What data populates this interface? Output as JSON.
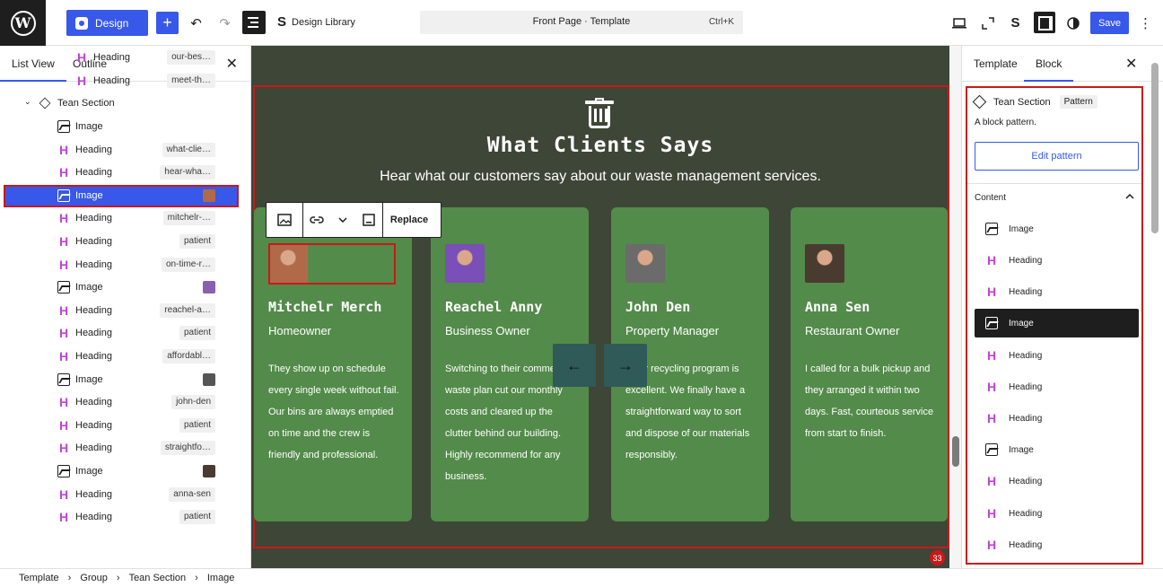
{
  "topbar": {
    "design_label": "Design",
    "plus": "+",
    "undo": "↶",
    "redo": "↷",
    "design_library_label": "Design Library",
    "command_title": "Front Page · Template",
    "command_shortcut": "Ctrl+K",
    "save_label": "Save",
    "more": "⋮"
  },
  "left_panel": {
    "tabs": [
      "List View",
      "Outline"
    ],
    "close": "✕",
    "rows": [
      {
        "type": "heading",
        "label": "Heading",
        "anchor": "our-bes…",
        "indent": 84
      },
      {
        "type": "heading",
        "label": "Heading",
        "anchor": "meet-th…",
        "indent": 84
      },
      {
        "type": "group",
        "label": "Tean Section",
        "anchor": "",
        "indent": 44
      },
      {
        "type": "image",
        "label": "Image",
        "anchor": "",
        "indent": 64
      },
      {
        "type": "heading",
        "label": "Heading",
        "anchor": "what-clie…",
        "indent": 64
      },
      {
        "type": "heading",
        "label": "Heading",
        "anchor": "hear-wha…",
        "indent": 64
      },
      {
        "type": "image",
        "label": "Image",
        "anchor": "",
        "indent": 64,
        "thumb": "#b06a4a",
        "selected": true
      },
      {
        "type": "heading",
        "label": "Heading",
        "anchor": "mitchelr-…",
        "indent": 64
      },
      {
        "type": "heading",
        "label": "Heading",
        "anchor": "patient",
        "indent": 64
      },
      {
        "type": "heading",
        "label": "Heading",
        "anchor": "on-time-r…",
        "indent": 64
      },
      {
        "type": "image",
        "label": "Image",
        "anchor": "",
        "indent": 64,
        "thumb": "#8a5fb0"
      },
      {
        "type": "heading",
        "label": "Heading",
        "anchor": "reachel-a…",
        "indent": 64
      },
      {
        "type": "heading",
        "label": "Heading",
        "anchor": "patient",
        "indent": 64
      },
      {
        "type": "heading",
        "label": "Heading",
        "anchor": "affordabl…",
        "indent": 64
      },
      {
        "type": "image",
        "label": "Image",
        "anchor": "",
        "indent": 64,
        "thumb": "#555555"
      },
      {
        "type": "heading",
        "label": "Heading",
        "anchor": "john-den",
        "indent": 64
      },
      {
        "type": "heading",
        "label": "Heading",
        "anchor": "patient",
        "indent": 64
      },
      {
        "type": "heading",
        "label": "Heading",
        "anchor": "straightfo…",
        "indent": 64
      },
      {
        "type": "image",
        "label": "Image",
        "anchor": "",
        "indent": 64,
        "thumb": "#4a3b30"
      },
      {
        "type": "heading",
        "label": "Heading",
        "anchor": "anna-sen",
        "indent": 64
      },
      {
        "type": "heading",
        "label": "Heading",
        "anchor": "patient",
        "indent": 64
      }
    ]
  },
  "canvas": {
    "title": "What Clients Says",
    "subtitle": "Hear what our customers say about our waste management services.",
    "toolbar_replace": "Replace",
    "prev_arrow": "←",
    "next_arrow": "→",
    "notice_count": "33",
    "cards": [
      {
        "name": "Mitchelr Merch",
        "role": "Homeowner",
        "quote": "They show up on schedule every single week without fail. Our bins are always emptied on time and the crew is friendly and professional.",
        "avatar": "#b06a4a"
      },
      {
        "name": "Reachel Anny",
        "role": "Business Owner",
        "quote": "Switching to their commercial waste plan cut our monthly costs and cleared up the clutter behind our building. Highly recommend for any business.",
        "avatar": "#7a4fb8"
      },
      {
        "name": "John Den",
        "role": "Property Manager",
        "quote": "Their recycling program is excellent. We finally have a straightforward way to sort and dispose of our materials responsibly.",
        "avatar": "#6b6b6b"
      },
      {
        "name": "Anna Sen",
        "role": "Restaurant Owner",
        "quote": "I called for a bulk pickup and they arranged it within two days. Fast, courteous service from start to finish.",
        "avatar": "#4a3b30"
      }
    ]
  },
  "right_panel": {
    "tabs": [
      "Template",
      "Block"
    ],
    "close": "✕",
    "block_name": "Tean Section",
    "block_badge": "Pattern",
    "block_desc": "A block pattern.",
    "edit_pattern": "Edit pattern",
    "content_label": "Content",
    "content_items": [
      {
        "type": "image",
        "label": "Image"
      },
      {
        "type": "heading",
        "label": "Heading"
      },
      {
        "type": "heading",
        "label": "Heading"
      },
      {
        "type": "image",
        "label": "Image",
        "active": true
      },
      {
        "type": "heading",
        "label": "Heading"
      },
      {
        "type": "heading",
        "label": "Heading"
      },
      {
        "type": "heading",
        "label": "Heading"
      },
      {
        "type": "image",
        "label": "Image"
      },
      {
        "type": "heading",
        "label": "Heading"
      },
      {
        "type": "heading",
        "label": "Heading"
      },
      {
        "type": "heading",
        "label": "Heading"
      }
    ]
  },
  "breadcrumbs": [
    "Template",
    "Group",
    "Tean Section",
    "Image"
  ]
}
